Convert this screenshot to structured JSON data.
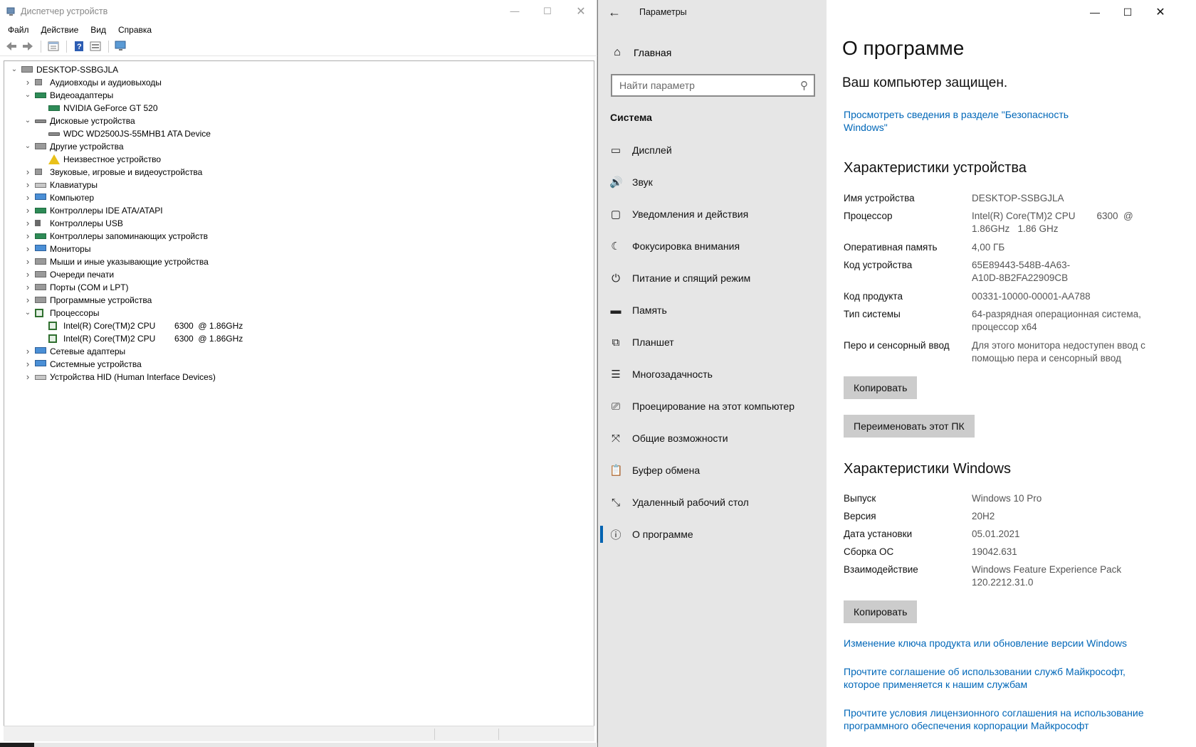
{
  "device_manager": {
    "title": "Диспетчер устройств",
    "menu": [
      "Файл",
      "Действие",
      "Вид",
      "Справка"
    ],
    "toolbar_icons": [
      "back-arrow-icon",
      "forward-arrow-icon",
      "properties-icon",
      "help-icon",
      "update-driver-icon",
      "scan-hardware-icon"
    ],
    "tree": [
      {
        "label": "DESKTOP-SSBGJLA",
        "level": 0,
        "expander": "expanded",
        "icon": "computer-icon"
      },
      {
        "label": "Аудиовходы и аудиовыходы",
        "level": 1,
        "expander": "collapsed",
        "icon": "speaker-icon"
      },
      {
        "label": "Видеоадаптеры",
        "level": 1,
        "expander": "expanded",
        "icon": "display-adapter-icon"
      },
      {
        "label": "NVIDIA GeForce GT 520",
        "level": 2,
        "expander": "none",
        "icon": "display-adapter-icon"
      },
      {
        "label": "Дисковые устройства",
        "level": 1,
        "expander": "expanded",
        "icon": "disk-icon"
      },
      {
        "label": "WDC WD2500JS-55MHB1 ATA Device",
        "level": 2,
        "expander": "none",
        "icon": "disk-icon"
      },
      {
        "label": "Другие устройства",
        "level": 1,
        "expander": "expanded",
        "icon": "other-devices-icon"
      },
      {
        "label": "Неизвестное устройство",
        "level": 2,
        "expander": "none",
        "icon": "warning-icon"
      },
      {
        "label": "Звуковые, игровые и видеоустройства",
        "level": 1,
        "expander": "collapsed",
        "icon": "speaker-icon"
      },
      {
        "label": "Клавиатуры",
        "level": 1,
        "expander": "collapsed",
        "icon": "keyboard-icon"
      },
      {
        "label": "Компьютер",
        "level": 1,
        "expander": "collapsed",
        "icon": "monitor-icon"
      },
      {
        "label": "Контроллеры IDE ATA/ATAPI",
        "level": 1,
        "expander": "collapsed",
        "icon": "card-icon"
      },
      {
        "label": "Контроллеры USB",
        "level": 1,
        "expander": "collapsed",
        "icon": "usb-icon"
      },
      {
        "label": "Контроллеры запоминающих устройств",
        "level": 1,
        "expander": "collapsed",
        "icon": "storage-icon"
      },
      {
        "label": "Мониторы",
        "level": 1,
        "expander": "collapsed",
        "icon": "monitor-icon"
      },
      {
        "label": "Мыши и иные указывающие устройства",
        "level": 1,
        "expander": "collapsed",
        "icon": "mouse-icon"
      },
      {
        "label": "Очереди печати",
        "level": 1,
        "expander": "collapsed",
        "icon": "printer-icon"
      },
      {
        "label": "Порты (COM и LPT)",
        "level": 1,
        "expander": "collapsed",
        "icon": "port-icon"
      },
      {
        "label": "Программные устройства",
        "level": 1,
        "expander": "collapsed",
        "icon": "software-device-icon"
      },
      {
        "label": "Процессоры",
        "level": 1,
        "expander": "expanded",
        "icon": "processor-icon"
      },
      {
        "label": "Intel(R) Core(TM)2 CPU        6300  @ 1.86GHz",
        "level": 2,
        "expander": "none",
        "icon": "processor-icon"
      },
      {
        "label": "Intel(R) Core(TM)2 CPU        6300  @ 1.86GHz",
        "level": 2,
        "expander": "none",
        "icon": "processor-icon"
      },
      {
        "label": "Сетевые адаптеры",
        "level": 1,
        "expander": "collapsed",
        "icon": "network-icon"
      },
      {
        "label": "Системные устройства",
        "level": 1,
        "expander": "collapsed",
        "icon": "system-devices-icon"
      },
      {
        "label": "Устройства HID (Human Interface Devices)",
        "level": 1,
        "expander": "collapsed",
        "icon": "hid-icon"
      }
    ]
  },
  "settings": {
    "title": "Параметры",
    "home": "Главная",
    "search_placeholder": "Найти параметр",
    "section": "Система",
    "nav": [
      {
        "label": "Дисплей",
        "icon": "display-icon",
        "glyph": "▭"
      },
      {
        "label": "Звук",
        "icon": "sound-icon",
        "glyph": "🔊"
      },
      {
        "label": "Уведомления и действия",
        "icon": "notifications-icon",
        "glyph": "▢"
      },
      {
        "label": "Фокусировка внимания",
        "icon": "focus-moon-icon",
        "glyph": "☾"
      },
      {
        "label": "Питание и спящий режим",
        "icon": "power-icon",
        "glyph": "⏻"
      },
      {
        "label": "Память",
        "icon": "storage-icon",
        "glyph": "▬"
      },
      {
        "label": "Планшет",
        "icon": "tablet-icon",
        "glyph": "⧉"
      },
      {
        "label": "Многозадачность",
        "icon": "multitasking-icon",
        "glyph": "☰"
      },
      {
        "label": "Проецирование на этот компьютер",
        "icon": "projecting-icon",
        "glyph": "⎚"
      },
      {
        "label": "Общие возможности",
        "icon": "shared-experiences-icon",
        "glyph": "⤧"
      },
      {
        "label": "Буфер обмена",
        "icon": "clipboard-icon",
        "glyph": "📋"
      },
      {
        "label": "Удаленный рабочий стол",
        "icon": "remote-desktop-icon",
        "glyph": "⤡"
      },
      {
        "label": "О программе",
        "icon": "info-icon",
        "glyph": "ⓘ",
        "active": true
      }
    ],
    "page_title": "О программе",
    "protected_text": "Ваш компьютер защищен.",
    "security_link": "Просмотреть сведения в разделе \"Безопасность Windows\"",
    "device_specs_heading": "Характеристики устройства",
    "device_specs": [
      {
        "key": "Имя устройства",
        "value": "DESKTOP-SSBGJLA"
      },
      {
        "key": "Процессор",
        "value": "Intel(R) Core(TM)2 CPU        6300  @\n1.86GHz   1.86 GHz"
      },
      {
        "key": "Оперативная память",
        "value": "4,00 ГБ"
      },
      {
        "key": "Код устройства",
        "value": "65E89443-548B-4A63-\nA10D-8B2FA22909CB"
      },
      {
        "key": "Код продукта",
        "value": "00331-10000-00001-AA788"
      },
      {
        "key": "Тип системы",
        "value": "64-разрядная операционная система,\nпроцессор x64"
      },
      {
        "key": "Перо и сенсорный ввод",
        "value": "Для этого монитора недоступен ввод с\nпомощью пера и сенсорный ввод"
      }
    ],
    "copy_button": "Копировать",
    "rename_button": "Переименовать этот ПК",
    "windows_specs_heading": "Характеристики Windows",
    "windows_specs": [
      {
        "key": "Выпуск",
        "value": "Windows 10 Pro"
      },
      {
        "key": "Версия",
        "value": "20H2"
      },
      {
        "key": "Дата установки",
        "value": "05.01.2021"
      },
      {
        "key": "Сборка ОС",
        "value": "19042.631"
      },
      {
        "key": "Взаимодействие",
        "value": "Windows Feature Experience Pack\n120.2212.31.0"
      }
    ],
    "copy_button_2": "Копировать",
    "links": [
      "Изменение ключа продукта или обновление версии Windows",
      "Прочтите соглашение об использовании служб Майкрософт, которое применяется к нашим службам",
      "Прочтите условия лицензионного соглашения на использование программного обеспечения корпорации Майкрософт"
    ]
  }
}
